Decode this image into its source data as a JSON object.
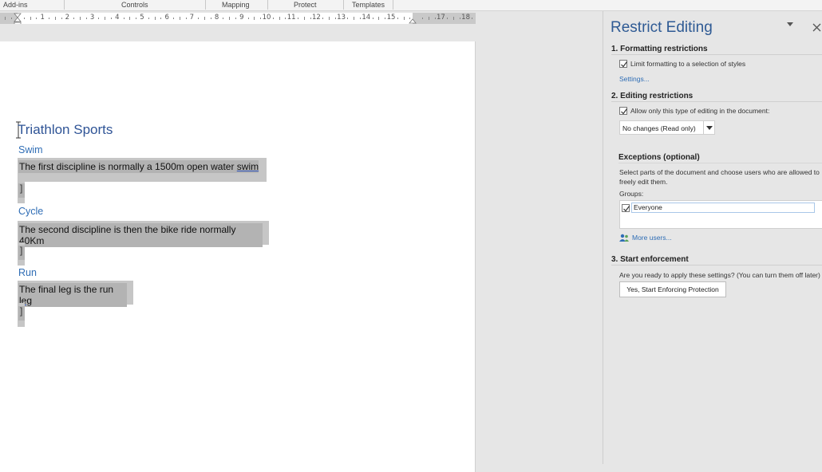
{
  "ribbon": {
    "groups": [
      "Add-ins",
      "Controls",
      "Mapping",
      "Protect",
      "Templates"
    ]
  },
  "ruler": {
    "ticks": [
      "1",
      "2",
      "3",
      "4",
      "5",
      "6",
      "7",
      "8",
      "9",
      "10",
      "11",
      "12",
      "13",
      "14",
      "15",
      "17",
      "18"
    ]
  },
  "document": {
    "title": "Triathlon Sports",
    "sections": [
      {
        "heading": "Swim",
        "body_text": "The first discipline is normally a 1500m open water ",
        "body_flagged_word": "swim"
      },
      {
        "heading": "Cycle",
        "body_text": "The second discipline is then the bike ride normally 40Km",
        "body_flagged_word": ""
      },
      {
        "heading": "Run",
        "body_text": "The final leg is the run ",
        "body_flagged_word": "leg"
      }
    ],
    "paragraph_end_mark": "]"
  },
  "pane": {
    "title": "Restrict Editing",
    "menu_icon": "dropdown-triangle-icon",
    "close_icon": "close-icon",
    "formatting": {
      "heading": "1. Formatting restrictions",
      "checkbox_label": "Limit formatting to a selection of styles",
      "checked": true,
      "settings_link": "Settings..."
    },
    "editing": {
      "heading": "2. Editing restrictions",
      "checkbox_label": "Allow only this type of editing in the document:",
      "checked": true,
      "select_value": "No changes (Read only)"
    },
    "exceptions": {
      "heading": "Exceptions (optional)",
      "description": "Select parts of the document and choose users who are allowed to freely edit them.",
      "groups_label": "Groups:",
      "groups": [
        {
          "name": "Everyone",
          "checked": true
        }
      ],
      "more_users_link": "More users..."
    },
    "enforcement": {
      "heading": "3. Start enforcement",
      "description": "Are you ready to apply these settings? (You can turn them off later)",
      "button_label": "Yes, Start Enforcing Protection"
    }
  }
}
